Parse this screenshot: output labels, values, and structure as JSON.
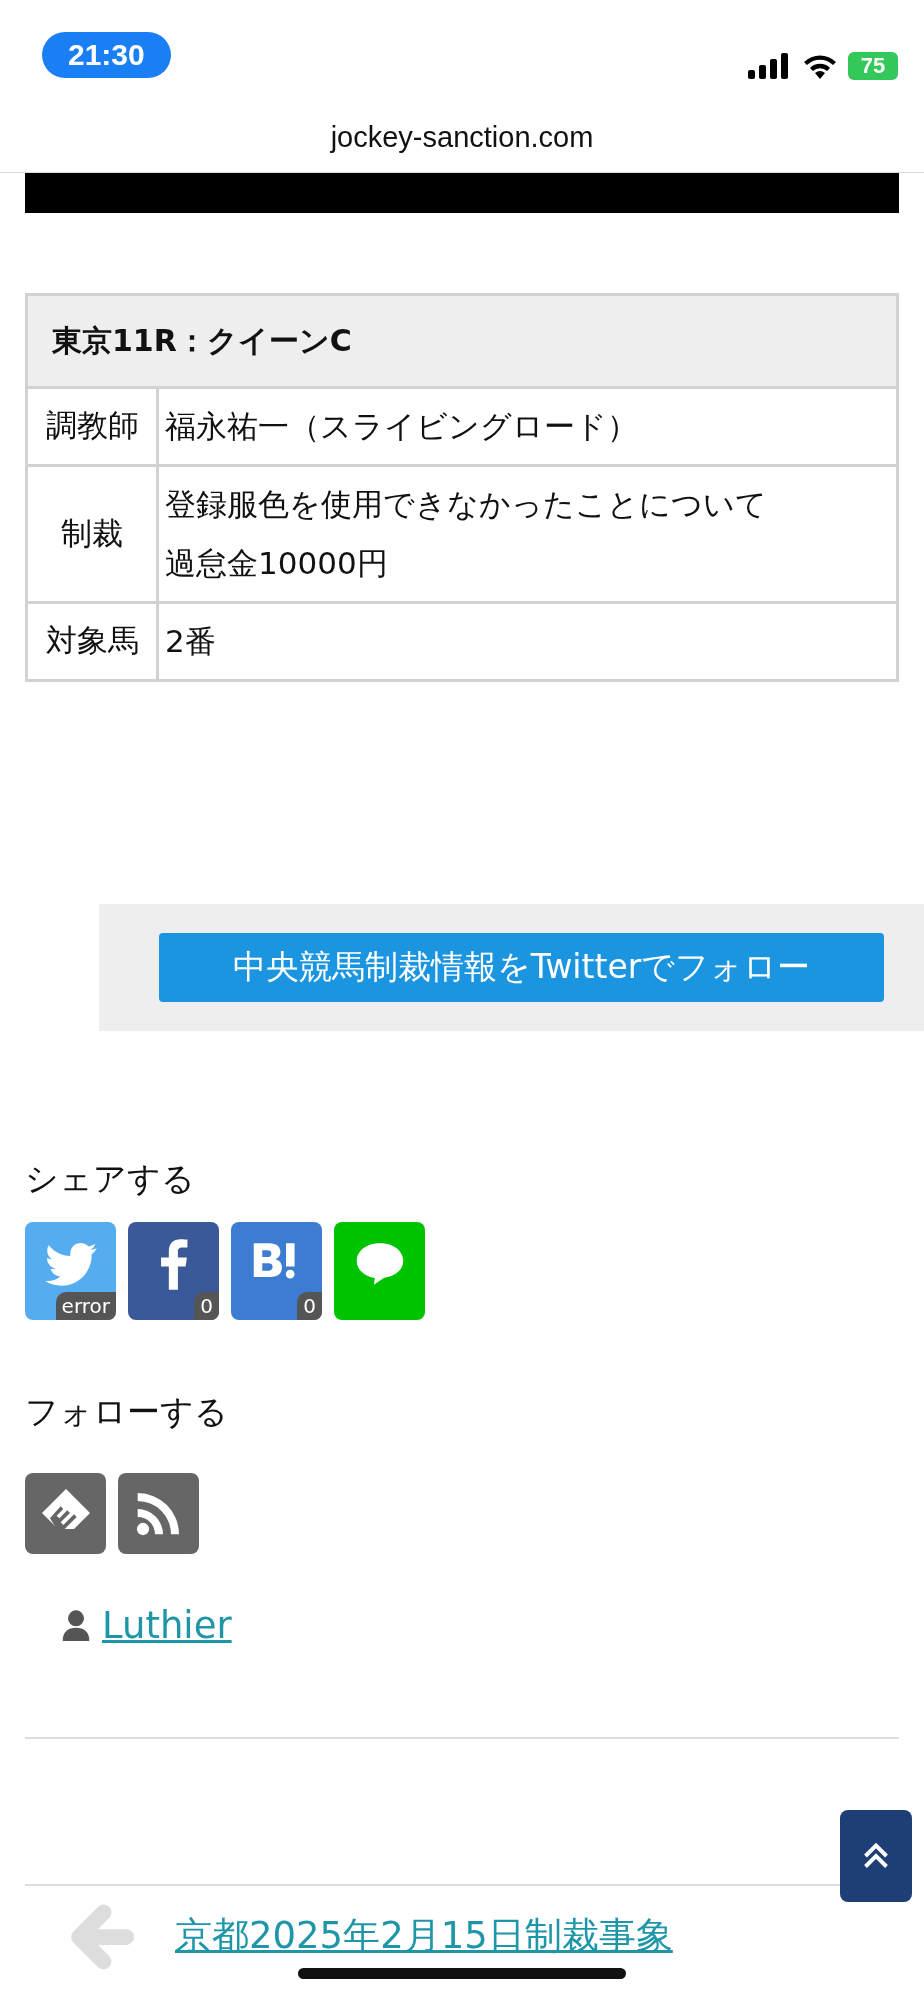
{
  "status_bar": {
    "time": "21:30",
    "battery": "75"
  },
  "address_bar": {
    "url": "jockey-sanction.com"
  },
  "table": {
    "title": "東京11R：クイーンC",
    "rows": [
      {
        "label": "調教師",
        "value": [
          "福永祐一（スライビングロード）"
        ]
      },
      {
        "label": "制裁",
        "value": [
          "登録服色を使用できなかったことについて",
          "過怠金10000円"
        ]
      },
      {
        "label": "対象馬",
        "value": [
          "2番"
        ]
      }
    ]
  },
  "follow_banner": {
    "button": "中央競馬制裁情報をTwitterでフォロー"
  },
  "share": {
    "heading": "シェアする",
    "buttons": [
      {
        "kind": "twitter",
        "count": "error"
      },
      {
        "kind": "facebook",
        "count": "0"
      },
      {
        "kind": "hatena",
        "count": "0"
      },
      {
        "kind": "line"
      }
    ]
  },
  "follow": {
    "heading": "フォローする",
    "buttons": [
      {
        "kind": "feedly"
      },
      {
        "kind": "rss"
      }
    ]
  },
  "author": {
    "name": "Luthier"
  },
  "prev_post": {
    "title": "京都2025年2月15日制裁事象"
  }
}
